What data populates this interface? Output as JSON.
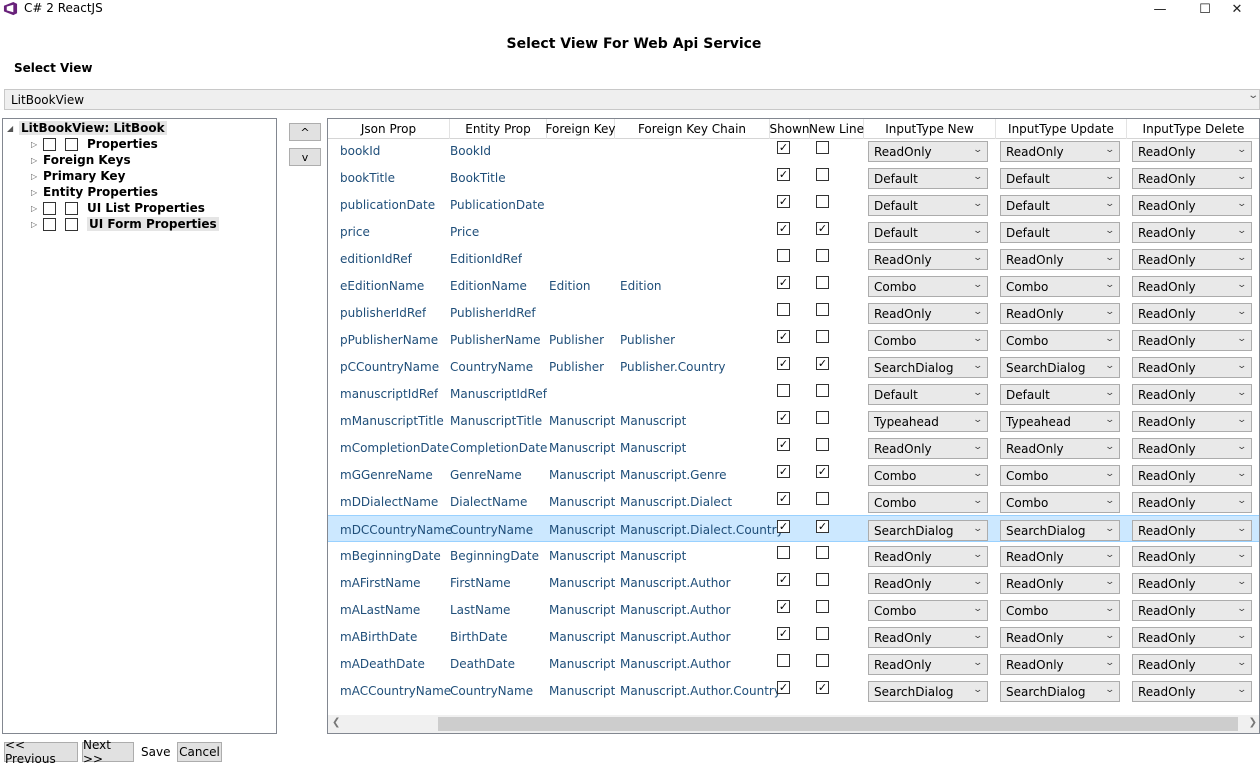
{
  "window": {
    "title": "C# 2 ReactJS",
    "minimize": "—",
    "maximize": "☐",
    "close": "✕",
    "brand_color": "#68217a"
  },
  "heading": "Select View For Web Api Service",
  "select_view": {
    "label": "Select View",
    "value": "LitBookView",
    "arrow": "⌄"
  },
  "tree": {
    "root": {
      "label": "LitBookView: LitBook"
    },
    "items": [
      {
        "label": "Properties",
        "has_checks": true
      },
      {
        "label": "Foreign Keys",
        "has_checks": false
      },
      {
        "label": "Primary Key",
        "has_checks": false
      },
      {
        "label": "Entity Properties",
        "has_checks": false
      },
      {
        "label": "UI List Properties",
        "has_checks": true
      },
      {
        "label": "UI Form Properties",
        "has_checks": true
      }
    ]
  },
  "move_buttons": {
    "up": "^",
    "down": "v"
  },
  "grid": {
    "columns": [
      "Json Prop",
      "Entity Prop",
      "Foreign Key",
      "Foreign Key Chain",
      "Shown",
      "New Line",
      "InputType New",
      "InputType Update",
      "InputType Delete"
    ],
    "rows": [
      {
        "json": "bookId",
        "entity": "BookId",
        "fk": "",
        "chain": "",
        "shown": true,
        "newline": false,
        "new": "ReadOnly",
        "update": "ReadOnly",
        "delete": "ReadOnly"
      },
      {
        "json": "bookTitle",
        "entity": "BookTitle",
        "fk": "",
        "chain": "",
        "shown": true,
        "newline": false,
        "new": "Default",
        "update": "Default",
        "delete": "ReadOnly"
      },
      {
        "json": "publicationDate",
        "entity": "PublicationDate",
        "fk": "",
        "chain": "",
        "shown": true,
        "newline": false,
        "new": "Default",
        "update": "Default",
        "delete": "ReadOnly"
      },
      {
        "json": "price",
        "entity": "Price",
        "fk": "",
        "chain": "",
        "shown": true,
        "newline": true,
        "new": "Default",
        "update": "Default",
        "delete": "ReadOnly"
      },
      {
        "json": "editionIdRef",
        "entity": "EditionIdRef",
        "fk": "",
        "chain": "",
        "shown": false,
        "newline": false,
        "new": "ReadOnly",
        "update": "ReadOnly",
        "delete": "ReadOnly"
      },
      {
        "json": "eEditionName",
        "entity": "EditionName",
        "fk": "Edition",
        "chain": "Edition",
        "shown": true,
        "newline": false,
        "new": "Combo",
        "update": "Combo",
        "delete": "ReadOnly"
      },
      {
        "json": "publisherIdRef",
        "entity": "PublisherIdRef",
        "fk": "",
        "chain": "",
        "shown": false,
        "newline": false,
        "new": "ReadOnly",
        "update": "ReadOnly",
        "delete": "ReadOnly"
      },
      {
        "json": "pPublisherName",
        "entity": "PublisherName",
        "fk": "Publisher",
        "chain": "Publisher",
        "shown": true,
        "newline": false,
        "new": "Combo",
        "update": "Combo",
        "delete": "ReadOnly"
      },
      {
        "json": "pCCountryName",
        "entity": "CountryName",
        "fk": "Publisher",
        "chain": "Publisher.Country",
        "shown": true,
        "newline": true,
        "new": "SearchDialog",
        "update": "SearchDialog",
        "delete": "ReadOnly"
      },
      {
        "json": "manuscriptIdRef",
        "entity": "ManuscriptIdRef",
        "fk": "",
        "chain": "",
        "shown": false,
        "newline": false,
        "new": "Default",
        "update": "Default",
        "delete": "ReadOnly"
      },
      {
        "json": "mManuscriptTitle",
        "entity": "ManuscriptTitle",
        "fk": "Manuscript",
        "chain": "Manuscript",
        "shown": true,
        "newline": false,
        "new": "Typeahead",
        "update": "Typeahead",
        "delete": "ReadOnly"
      },
      {
        "json": "mCompletionDate",
        "entity": "CompletionDate",
        "fk": "Manuscript",
        "chain": "Manuscript",
        "shown": true,
        "newline": false,
        "new": "ReadOnly",
        "update": "ReadOnly",
        "delete": "ReadOnly"
      },
      {
        "json": "mGGenreName",
        "entity": "GenreName",
        "fk": "Manuscript",
        "chain": "Manuscript.Genre",
        "shown": true,
        "newline": true,
        "new": "Combo",
        "update": "Combo",
        "delete": "ReadOnly"
      },
      {
        "json": "mDDialectName",
        "entity": "DialectName",
        "fk": "Manuscript",
        "chain": "Manuscript.Dialect",
        "shown": true,
        "newline": false,
        "new": "Combo",
        "update": "Combo",
        "delete": "ReadOnly"
      },
      {
        "json": "mDCCountryName",
        "entity": "CountryName",
        "fk": "Manuscript",
        "chain": "Manuscript.Dialect.Country",
        "shown": true,
        "newline": true,
        "new": "SearchDialog",
        "update": "SearchDialog",
        "delete": "ReadOnly",
        "selected": true
      },
      {
        "json": "mBeginningDate",
        "entity": "BeginningDate",
        "fk": "Manuscript",
        "chain": "Manuscript",
        "shown": false,
        "newline": false,
        "new": "ReadOnly",
        "update": "ReadOnly",
        "delete": "ReadOnly"
      },
      {
        "json": "mAFirstName",
        "entity": "FirstName",
        "fk": "Manuscript",
        "chain": "Manuscript.Author",
        "shown": true,
        "newline": false,
        "new": "ReadOnly",
        "update": "ReadOnly",
        "delete": "ReadOnly"
      },
      {
        "json": "mALastName",
        "entity": "LastName",
        "fk": "Manuscript",
        "chain": "Manuscript.Author",
        "shown": true,
        "newline": false,
        "new": "Combo",
        "update": "Combo",
        "delete": "ReadOnly"
      },
      {
        "json": "mABirthDate",
        "entity": "BirthDate",
        "fk": "Manuscript",
        "chain": "Manuscript.Author",
        "shown": true,
        "newline": false,
        "new": "ReadOnly",
        "update": "ReadOnly",
        "delete": "ReadOnly"
      },
      {
        "json": "mADeathDate",
        "entity": "DeathDate",
        "fk": "Manuscript",
        "chain": "Manuscript.Author",
        "shown": false,
        "newline": false,
        "new": "ReadOnly",
        "update": "ReadOnly",
        "delete": "ReadOnly"
      },
      {
        "json": "mACCountryName",
        "entity": "CountryName",
        "fk": "Manuscript",
        "chain": "Manuscript.Author.Country",
        "shown": true,
        "newline": true,
        "new": "SearchDialog",
        "update": "SearchDialog",
        "delete": "ReadOnly"
      }
    ]
  },
  "footer": {
    "previous": "<< Previous",
    "next": "Next >>",
    "save": "Save",
    "cancel": "Cancel"
  }
}
